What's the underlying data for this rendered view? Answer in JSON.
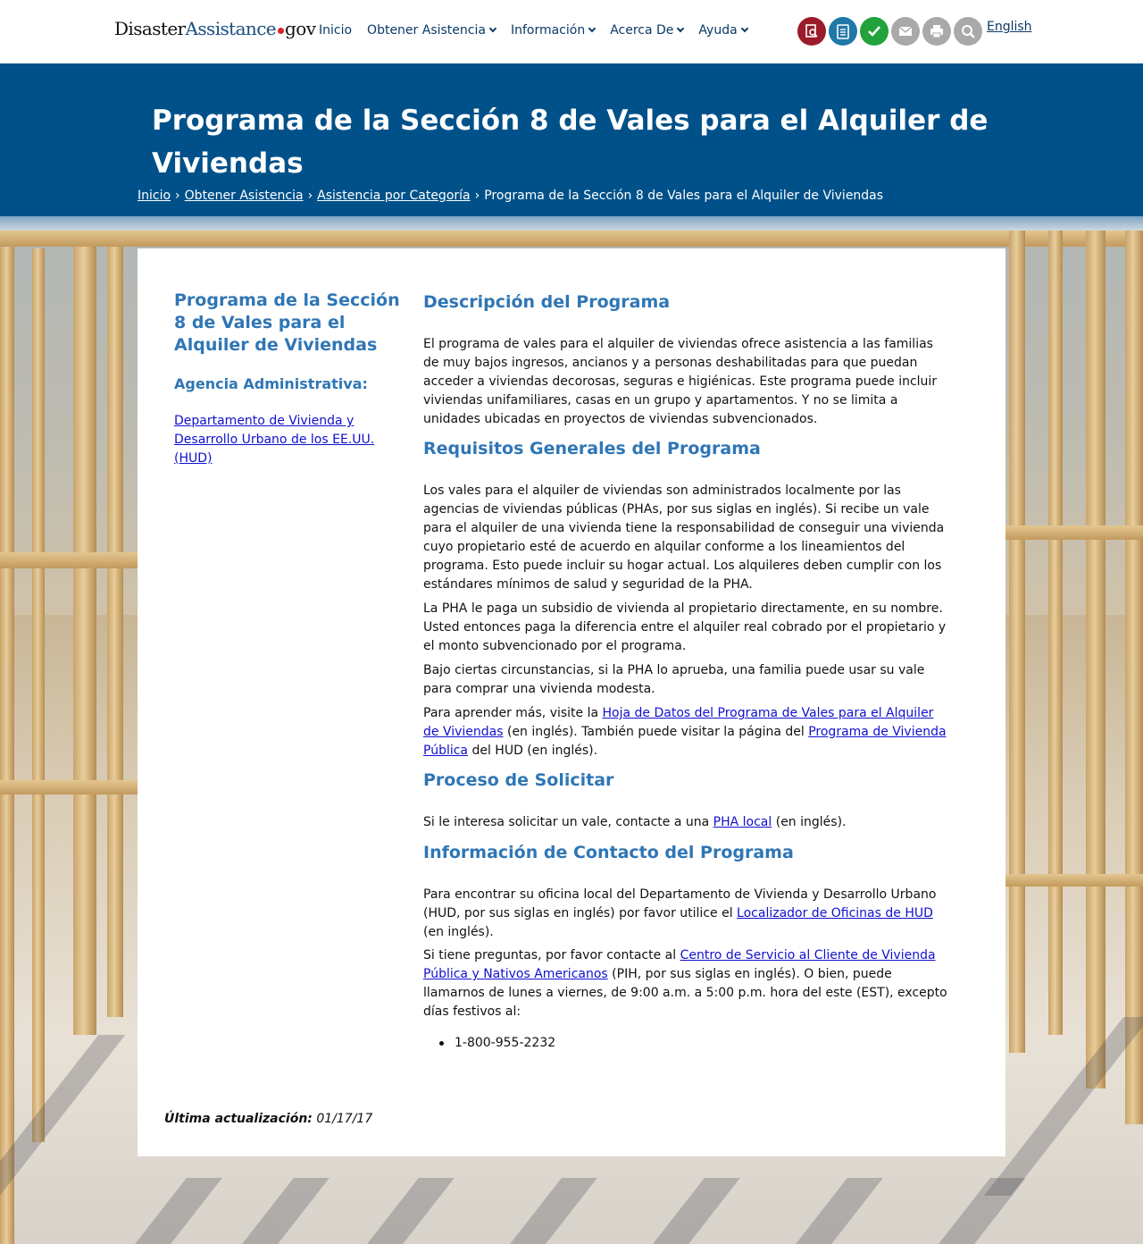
{
  "logo": {
    "part1": "Disaster",
    "part2": "Assistance",
    "part3": "gov"
  },
  "nav": {
    "items": [
      {
        "label": "Inicio",
        "dropdown": false
      },
      {
        "label": "Obtener Asistencia",
        "dropdown": true
      },
      {
        "label": "Información",
        "dropdown": true
      },
      {
        "label": "Acerca De",
        "dropdown": true
      },
      {
        "label": "Ayuda",
        "dropdown": true
      }
    ],
    "tools": [
      {
        "icon": "search-document-icon",
        "color": "#9b1b2a"
      },
      {
        "icon": "checklist-icon",
        "color": "#1f78a8"
      },
      {
        "icon": "checkmark-icon",
        "color": "#21a23b"
      },
      {
        "icon": "envelope-icon",
        "color": "#a9a9a9"
      },
      {
        "icon": "printer-icon",
        "color": "#a9a9a9"
      },
      {
        "icon": "magnifier-icon",
        "color": "#a9a9a9"
      }
    ],
    "language": "English"
  },
  "header": {
    "title": "Programa de la Sección 8 de Vales para el Alquiler de Viviendas",
    "breadcrumb": [
      "Inicio",
      "Obtener Asistencia",
      "Asistencia por Categoría"
    ],
    "breadcrumb_current": "Programa de la Sección 8 de Vales para el Alquiler de Viviendas",
    "sep": "›"
  },
  "sidebar": {
    "title": "Programa de la Sección 8 de Vales para el Alquiler de Viviendas",
    "agency_label": "Agencia Administrativa:",
    "agency_link": "Departamento de Vivienda y Desarrollo Urbano de los EE.UU. (HUD)"
  },
  "content": {
    "s1_heading": "Descripción del Programa",
    "s1_p1": "El programa de vales para el alquiler de viviendas ofrece asistencia a las familias de muy bajos ingresos, ancianos y a personas deshabilitadas para que puedan acceder a viviendas decorosas, seguras e higiénicas. Este programa puede incluir viviendas unifamiliares, casas en un grupo y apartamentos. Y no se limita a unidades ubicadas en proyectos de viviendas subvencionados.",
    "s2_heading": "Requisitos Generales del Programa",
    "s2_p1": "Los vales para el alquiler de viviendas son administrados localmente por las agencias de viviendas públicas (PHAs, por sus siglas en inglés). Si recibe un vale para el alquiler de una vivienda tiene la responsabilidad de conseguir una vivienda cuyo propietario esté de acuerdo en alquilar conforme a los lineamientos del programa. Esto puede incluir su hogar actual. Los alquileres deben cumplir con los estándares mínimos de salud y seguridad de la PHA.",
    "s2_p2": "La PHA le paga un subsidio de vivienda al propietario directamente, en su nombre. Usted entonces paga la diferencia entre el alquiler real cobrado por el propietario y el monto subvencionado por el programa.",
    "s2_p3": "Bajo ciertas circunstancias, si la PHA lo aprueba, una familia puede usar su vale para comprar una vivienda modesta.",
    "s2_p4_a": "Para aprender más, visite la ",
    "s2_p4_link1": "Hoja de Datos del Programa de Vales para el Alquiler de Viviendas",
    "s2_p4_b": " (en inglés). También puede visitar la página del ",
    "s2_p4_link2": "Programa de Vivienda Pública",
    "s2_p4_c": " del HUD (en inglés).",
    "s3_heading": "Proceso de Solicitar",
    "s3_p1_a": "Si le interesa solicitar un vale, contacte a una ",
    "s3_p1_link": "PHA local",
    "s3_p1_b": " (en inglés).",
    "s4_heading": "Información de Contacto del Programa",
    "s4_p1_a": "Para encontrar su oficina local del Departamento de Vivienda y Desarrollo Urbano (HUD, por sus siglas en inglés) por favor utilice el ",
    "s4_p1_link": "Localizador de Oficinas de HUD",
    "s4_p1_b": " (en inglés).",
    "s4_p2_a": "Si tiene preguntas, por favor contacte al ",
    "s4_p2_link": "Centro de Servicio al Cliente de Vivienda Pública y Nativos Americanos",
    "s4_p2_b": " (PIH, por sus siglas en inglés). O bien, puede llamarnos de lunes a viernes, de 9:00 a.m. a 5:00 p.m. hora del este (EST), excepto días festivos al:",
    "phone": "1-800-955-2232"
  },
  "footer": {
    "updated_label": "Última actualización:",
    "updated_value": "01/17/17"
  }
}
